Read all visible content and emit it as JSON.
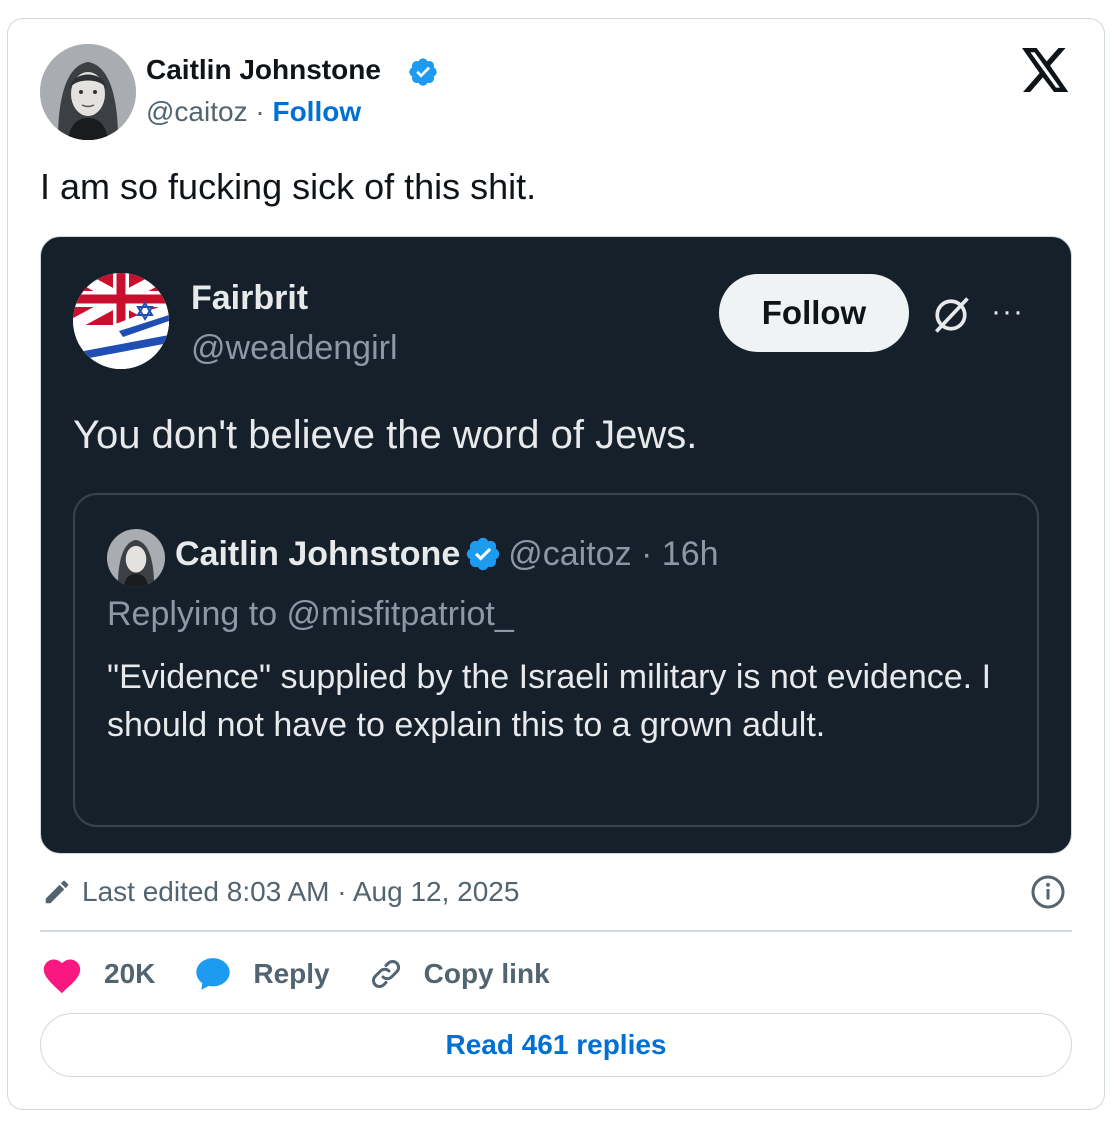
{
  "tweet": {
    "author_name": "Caitlin Johnstone",
    "author_handle": "@caitoz",
    "separator": " · ",
    "follow_label": "Follow",
    "text": "I am so fucking sick of this shit."
  },
  "quoted": {
    "author_name": "Fairbrit",
    "author_handle": "@wealdengirl",
    "follow_label": "Follow",
    "more_label": "···",
    "text": "You don't believe the word of Jews.",
    "inner": {
      "author_name": "Caitlin Johnstone",
      "meta": "@caitoz · 16h",
      "replying_to": "Replying to @misfitpatriot_",
      "text": "\"Evidence\" supplied by the Israeli military is not evidence. I should not have to explain this to a grown adult."
    }
  },
  "footer": {
    "edited": "Last edited 8:03 AM · Aug 12, 2025",
    "like_count": "20K",
    "reply_label": "Reply",
    "copy_label": "Copy link",
    "read_replies": "Read 461 replies"
  },
  "icons": [
    "verified-badge-icon",
    "x-logo-icon",
    "grok-icon",
    "more-icon",
    "pencil-icon",
    "info-icon",
    "heart-icon",
    "reply-bubble-icon",
    "link-icon"
  ],
  "colors": {
    "accent": "#006fd6",
    "verified": "#1d9bf0",
    "like": "#f91880",
    "dark_bg": "#15202b"
  }
}
